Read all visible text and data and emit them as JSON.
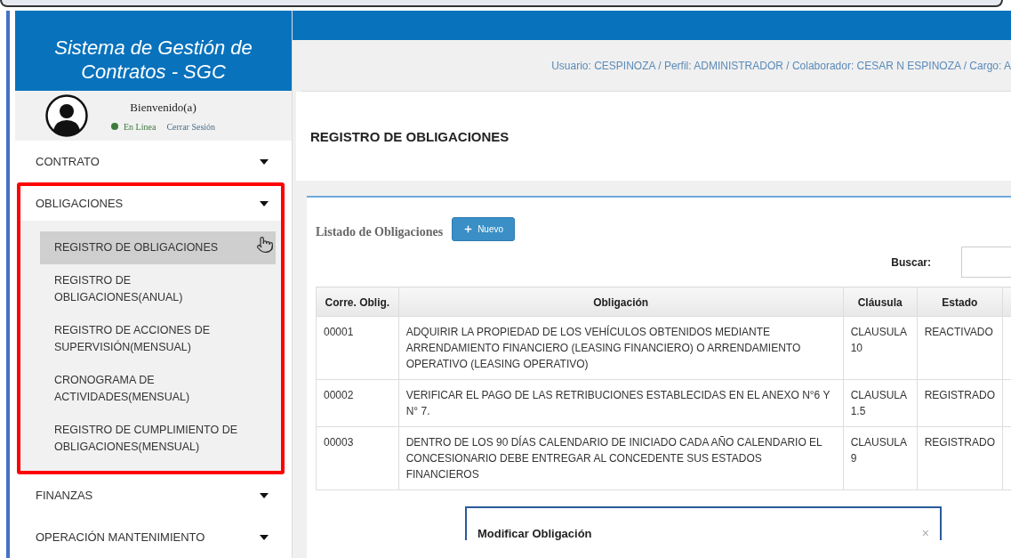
{
  "app_title": "Sistema de Gestión de Contratos - SGC",
  "user": {
    "greeting": "Bienvenido(a)",
    "status": "En Linea",
    "logout": "Cerrar Sesión"
  },
  "menu": [
    {
      "label": "CONTRATO",
      "highlighted": false
    },
    {
      "label": "OBLIGACIONES",
      "highlighted": true,
      "children": [
        {
          "label": "REGISTRO DE OBLIGACIONES",
          "selected": true
        },
        {
          "label": "REGISTRO DE OBLIGACIONES(ANUAL)",
          "selected": false
        },
        {
          "label": "REGISTRO DE ACCIONES DE SUPERVISIÓN(MENSUAL)",
          "selected": false
        },
        {
          "label": "CRONOGRAMA DE ACTIVIDADES(MENSUAL)",
          "selected": false
        },
        {
          "label": "REGISTRO DE CUMPLIMIENTO DE OBLIGACIONES(MENSUAL)",
          "selected": false
        }
      ]
    },
    {
      "label": "FINANZAS",
      "highlighted": false
    },
    {
      "label": "OPERACIÓN MANTENIMIENTO",
      "highlighted": false
    }
  ],
  "header": {
    "user_info": "Usuario: CESPINOZA / Perfil: ADMINISTRADOR / Colaborador: CESAR N ESPINOZA / Cargo: A"
  },
  "page_title": "REGISTRO DE OBLIGACIONES",
  "list": {
    "title": "Listado de Obligaciones",
    "new_button": "Nuevo",
    "search_label": "Buscar:"
  },
  "table": {
    "columns": [
      "Corre. Oblig.",
      "Obligación",
      "Cláusula",
      "Estado"
    ],
    "rows": [
      {
        "cells": [
          "00001",
          "ADQUIRIR LA PROPIEDAD DE LOS VEHÍCULOS OBTENIDOS MEDIANTE ARRENDAMIENTO FINANCIERO (LEASING FINANCIERO) O ARRENDAMIENTO OPERATIVO (LEASING OPERATIVO)",
          "CLAUSULA 10",
          "REACTIVADO"
        ]
      },
      {
        "cells": [
          "00002",
          "VERIFICAR EL PAGO DE LAS RETRIBUCIONES ESTABLECIDAS EN EL ANEXO N°6 Y N° 7.",
          "CLAUSULA 1.5",
          "REGISTRADO"
        ]
      },
      {
        "cells": [
          "00003",
          "DENTRO DE LOS 90 DÍAS CALENDARIO DE INICIADO CADA AÑO CALENDARIO EL CONCESIONARIO DEBE ENTREGAR AL CONCEDENTE SUS ESTADOS FINANCIEROS",
          "CLAUSULA 9",
          "REGISTRADO"
        ]
      }
    ]
  },
  "modal": {
    "title": "Modificar Obligación",
    "close": "×"
  }
}
